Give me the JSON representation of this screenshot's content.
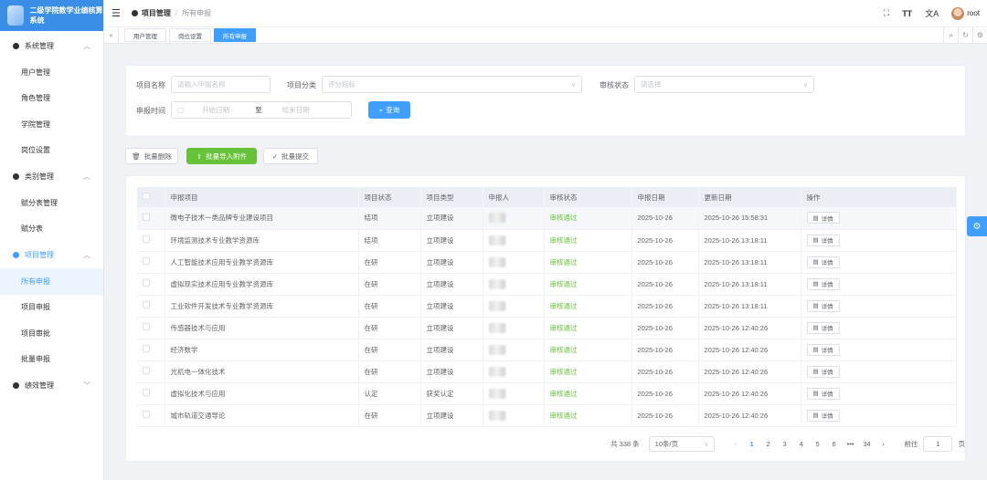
{
  "app": {
    "title": "二级学院教学业绩核算系统"
  },
  "sidebar": {
    "groups": [
      {
        "label": "系统管理",
        "items": [
          "用户管理",
          "角色管理",
          "学院管理",
          "岗位设置"
        ]
      },
      {
        "label": "类别管理",
        "items": [
          "赋分表管理",
          "赋分表"
        ]
      },
      {
        "label": "项目管理",
        "items": [
          "所有申报",
          "项目申报",
          "项目审批",
          "批量申报"
        ]
      },
      {
        "label": "绩效管理",
        "items": []
      }
    ]
  },
  "header": {
    "breadcrumb": [
      "项目管理",
      "所有申报"
    ],
    "user": "root"
  },
  "tabs": [
    {
      "label": "用户管理"
    },
    {
      "label": "岗位设置"
    },
    {
      "label": "所有申报"
    }
  ],
  "filter": {
    "name_label": "项目名称",
    "name_placeholder": "请输入申报名称",
    "category_label": "项目分类",
    "category_placeholder": "评分指标",
    "status_label": "审核状态",
    "status_placeholder": "请选择",
    "date_label": "申报时间",
    "start_placeholder": "开始日期",
    "date_sep": "至",
    "end_placeholder": "结束日期",
    "query_label": "查询"
  },
  "actions": {
    "batch_delete": "批量删除",
    "batch_import": "批量导入附件",
    "batch_submit": "批量提交"
  },
  "table": {
    "columns": [
      "申报项目",
      "项目状态",
      "项目类型",
      "申报人",
      "审核状态",
      "申报日期",
      "更新日期",
      "操作"
    ],
    "detail_label": "详情",
    "rows": [
      [
        "微电子技术一类品牌专业建设项目",
        "结项",
        "立项建设",
        "",
        "审核通过",
        "2025-10-26",
        "2025-10-26 15:58:31"
      ],
      [
        "环境监测技术专业教学资源库",
        "结项",
        "立项建设",
        "",
        "审核通过",
        "2025-10-26",
        "2025-10-26 13:18:11"
      ],
      [
        "人工智能技术应用专业教学资源库",
        "在研",
        "立项建设",
        "",
        "审核通过",
        "2025-10-26",
        "2025-10-26 13:18:11"
      ],
      [
        "虚拟现实技术应用专业教学资源库",
        "在研",
        "立项建设",
        "",
        "审核通过",
        "2025-10-26",
        "2025-10-26 13:18:11"
      ],
      [
        "工业软件开发技术专业教学资源库",
        "在研",
        "立项建设",
        "",
        "审核通过",
        "2025-10-26",
        "2025-10-26 13:18:11"
      ],
      [
        "传感器技术与应用",
        "在研",
        "立项建设",
        "",
        "审核通过",
        "2025-10-26",
        "2025-10-26 12:40:26"
      ],
      [
        "经济数学",
        "在研",
        "立项建设",
        "",
        "审核通过",
        "2025-10-26",
        "2025-10-26 12:40:26"
      ],
      [
        "光机电一体化技术",
        "在研",
        "立项建设",
        "",
        "审核通过",
        "2025-10-26",
        "2025-10-26 12:40:26"
      ],
      [
        "虚拟化技术与应用",
        "认定",
        "获奖认定",
        "",
        "审核通过",
        "2025-10-26",
        "2025-10-26 12:40:26"
      ],
      [
        "城市轨道交通导论",
        "在研",
        "立项建设",
        "",
        "审核通过",
        "2025-10-26",
        "2025-10-26 12:40:26"
      ]
    ]
  },
  "pagination": {
    "total": "共 338 条",
    "page_size": "10条/页",
    "pages": [
      "1",
      "2",
      "3",
      "4",
      "5",
      "6"
    ],
    "ellipsis": "•••",
    "last": "34",
    "goto_label": "前往",
    "goto_value": "1",
    "goto_unit": "页"
  }
}
